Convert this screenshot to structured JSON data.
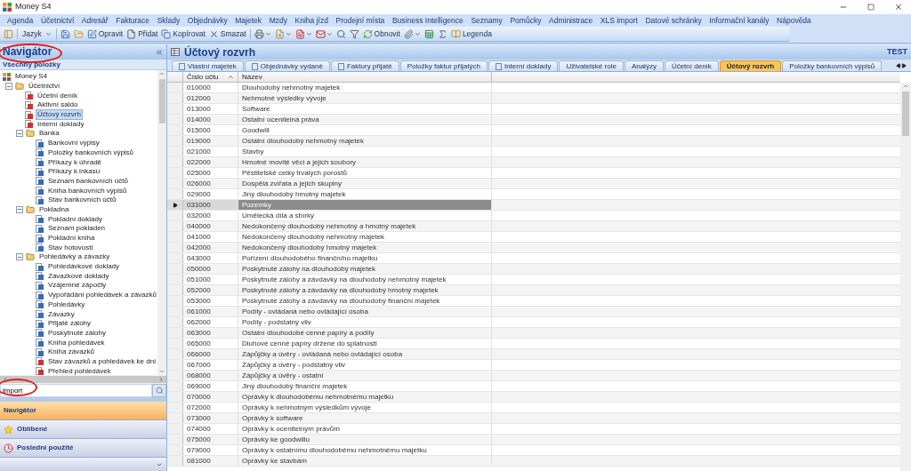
{
  "window": {
    "title": "Money S4"
  },
  "menu": [
    "Agenda",
    "Účetnictví",
    "Adresář",
    "Fakturace",
    "Sklady",
    "Objednávky",
    "Majetek",
    "Mzdy",
    "Kniha jízd",
    "Prodejní místa",
    "Business Intelligence",
    "Seznamy",
    "Pomůcky",
    "Administrace",
    "XLS import",
    "Datové schránky",
    "Informační kanály",
    "Nápověda"
  ],
  "toolbar": [
    {
      "kind": "icon"
    },
    {
      "kind": "separator"
    },
    {
      "kind": "dropdown",
      "label": "Jazyk"
    },
    {
      "kind": "separator"
    },
    {
      "kind": "icon"
    },
    {
      "kind": "icon"
    },
    {
      "kind": "button",
      "label": "Opravit"
    },
    {
      "kind": "button",
      "label": "Přidat"
    },
    {
      "kind": "button",
      "label": "Kopírovat"
    },
    {
      "kind": "button",
      "label": "Smazat"
    },
    {
      "kind": "separator"
    },
    {
      "kind": "icon_menu"
    },
    {
      "kind": "icon_menu"
    },
    {
      "kind": "icon_menu"
    },
    {
      "kind": "icon_menu"
    },
    {
      "kind": "icon"
    },
    {
      "kind": "icon"
    },
    {
      "kind": "button",
      "label": "Obnovit"
    },
    {
      "kind": "icon_menu"
    },
    {
      "kind": "icon"
    },
    {
      "kind": "icon"
    },
    {
      "kind": "button",
      "label": "Legenda"
    }
  ],
  "navigator": {
    "title": "Navigátor",
    "subtitle": "Všechny položky",
    "tree": [
      {
        "label": "Money S4",
        "selected": false,
        "children": [
          {
            "label": "Účetnictví",
            "selected": false,
            "expanded": true,
            "children": [
              {
                "label": "Účetní deník",
                "selected": false
              },
              {
                "label": "Aktivní saldo",
                "selected": false
              },
              {
                "label": "Účtový rozvrh",
                "selected": true
              },
              {
                "label": "Interní doklady",
                "selected": false
              },
              {
                "label": "Banka",
                "selected": false,
                "expanded": true,
                "children": [
                  {
                    "label": "Bankovní výpisy",
                    "selected": false
                  },
                  {
                    "label": "Položky bankovních výpisů",
                    "selected": false
                  },
                  {
                    "label": "Příkazy k úhradě",
                    "selected": false
                  },
                  {
                    "label": "Příkazy k inkasu",
                    "selected": false
                  },
                  {
                    "label": "Seznam bankovních účtů",
                    "selected": false
                  },
                  {
                    "label": "Kniha bankovních výpisů",
                    "selected": false
                  },
                  {
                    "label": "Stav bankovních účtů",
                    "selected": false
                  }
                ]
              },
              {
                "label": "Pokladna",
                "selected": false,
                "expanded": true,
                "children": [
                  {
                    "label": "Pokladní doklady",
                    "selected": false
                  },
                  {
                    "label": "Seznam pokladen",
                    "selected": false
                  },
                  {
                    "label": "Pokladní kniha",
                    "selected": false
                  },
                  {
                    "label": "Stav hotovosti",
                    "selected": false
                  }
                ]
              },
              {
                "label": "Pohledávky a závazky",
                "selected": false,
                "expanded": true,
                "children": [
                  {
                    "label": "Pohledávkové doklady",
                    "selected": false
                  },
                  {
                    "label": "Závazkové doklady",
                    "selected": false
                  },
                  {
                    "label": "Vzájemné zápočty",
                    "selected": false
                  },
                  {
                    "label": "Vypořádání pohledávek a závazků",
                    "selected": false
                  },
                  {
                    "label": "Pohledávky",
                    "selected": false
                  },
                  {
                    "label": "Závazky",
                    "selected": false
                  },
                  {
                    "label": "Přijaté zálohy",
                    "selected": false
                  },
                  {
                    "label": "Poskytnuté zálohy",
                    "selected": false
                  },
                  {
                    "label": "Kniha pohledávek",
                    "selected": false
                  },
                  {
                    "label": "Kniha závazků",
                    "selected": false
                  },
                  {
                    "label": "Stav závazků a pohledávek ke dni",
                    "selected": false
                  },
                  {
                    "label": "Přehled pohledávek",
                    "selected": false
                  }
                ]
              }
            ]
          }
        ]
      }
    ],
    "search": {
      "value": "import"
    },
    "sections": [
      {
        "label": "Navigátor",
        "selected": true
      },
      {
        "label": "Oblíbené",
        "selected": false
      },
      {
        "label": "Poslední použité",
        "selected": false
      }
    ]
  },
  "content": {
    "title": "Účtový rozvrh",
    "badge": "TEST",
    "tabs": [
      {
        "label": "Vlastní majetek",
        "has_icon": true,
        "selected": false
      },
      {
        "label": "Objednávky vydané",
        "has_icon": true,
        "selected": false
      },
      {
        "label": "Faktury přijaté",
        "has_icon": true,
        "selected": false
      },
      {
        "label": "Položky faktur přijatých",
        "has_icon": false,
        "selected": false
      },
      {
        "label": "Interní doklady",
        "has_icon": true,
        "selected": false
      },
      {
        "label": "Uživatelské role",
        "has_icon": false,
        "selected": false
      },
      {
        "label": "Analýzy",
        "has_icon": false,
        "selected": false
      },
      {
        "label": "Účetní deník",
        "has_icon": false,
        "selected": false
      },
      {
        "label": "Účtový rozvrh",
        "has_icon": false,
        "selected": true
      },
      {
        "label": "Položky bankovních výpisů",
        "has_icon": false,
        "selected": false
      }
    ],
    "table": {
      "columns": [
        {
          "label": "Číslo účtu",
          "sorted": true
        },
        {
          "label": "Název",
          "sorted": false
        }
      ],
      "rows": [
        {
          "cells": [
            "010000",
            "Dlouhodobý nehmotný majetek"
          ],
          "selected": false
        },
        {
          "cells": [
            "012000",
            "Nehmotné výsledky vývoje"
          ],
          "selected": false
        },
        {
          "cells": [
            "013000",
            "Software"
          ],
          "selected": false
        },
        {
          "cells": [
            "014000",
            "Ostatní ocenitelná práva"
          ],
          "selected": false
        },
        {
          "cells": [
            "015000",
            "Goodwill"
          ],
          "selected": false
        },
        {
          "cells": [
            "019000",
            "Ostatní dlouhodobý nehmotný majetek"
          ],
          "selected": false
        },
        {
          "cells": [
            "021000",
            "Stavby"
          ],
          "selected": false
        },
        {
          "cells": [
            "022000",
            "Hmotné movité věci a jejich soubory"
          ],
          "selected": false
        },
        {
          "cells": [
            "025000",
            "Pěstitelské celky trvalých porostů"
          ],
          "selected": false
        },
        {
          "cells": [
            "026000",
            "Dospělá zvířata a jejich skupiny"
          ],
          "selected": false
        },
        {
          "cells": [
            "029000",
            "Jiný dlouhodobý hmotný majetek"
          ],
          "selected": false
        },
        {
          "cells": [
            "031000",
            "Pozemky"
          ],
          "selected": true
        },
        {
          "cells": [
            "032000",
            "Umělecká díla a sbírky"
          ],
          "selected": false
        },
        {
          "cells": [
            "040000",
            "Nedokončený dlouhodobý nehmotný a hmotný majetek"
          ],
          "selected": false
        },
        {
          "cells": [
            "041000",
            "Nedokončený dlouhodobý nehmotný majetek"
          ],
          "selected": false
        },
        {
          "cells": [
            "042000",
            "Nedokončený dlouhodobý hmotný majetek"
          ],
          "selected": false
        },
        {
          "cells": [
            "043000",
            "Pořízení dlouhodobého finančního majetku"
          ],
          "selected": false
        },
        {
          "cells": [
            "050000",
            "Poskytnuté zálohy na dlouhodobý majetek"
          ],
          "selected": false
        },
        {
          "cells": [
            "051000",
            "Poskytnuté zálohy a závdavky na dlouhodobý nehmotný majetek"
          ],
          "selected": false
        },
        {
          "cells": [
            "052000",
            "Poskytnuté zálohy a závdavky na dlouhodobý hmotný majetek"
          ],
          "selected": false
        },
        {
          "cells": [
            "053000",
            "Poskytnuté zálohy a závdavky na dlouhodobý finanční majetek"
          ],
          "selected": false
        },
        {
          "cells": [
            "061000",
            "Podíly - ovládaná nebo ovládající osoba"
          ],
          "selected": false
        },
        {
          "cells": [
            "062000",
            "Podíly - podstatný vliv"
          ],
          "selected": false
        },
        {
          "cells": [
            "063000",
            "Ostatní dlouhodobé cenné papíry a podíly"
          ],
          "selected": false
        },
        {
          "cells": [
            "065000",
            "Dluhové cenné papíry držené do splatnosti"
          ],
          "selected": false
        },
        {
          "cells": [
            "066000",
            "Zápůjčky a úvěry - ovládaná nebo ovládající osoba"
          ],
          "selected": false
        },
        {
          "cells": [
            "067000",
            "Zápůjčky a úvěry - podstatný vliv"
          ],
          "selected": false
        },
        {
          "cells": [
            "068000",
            "Zápůjčky a úvěry - ostatní"
          ],
          "selected": false
        },
        {
          "cells": [
            "069000",
            "Jiný dlouhodobý finanční majetek"
          ],
          "selected": false
        },
        {
          "cells": [
            "070000",
            "Oprávky k dlouhodobému nehmotnému majetku"
          ],
          "selected": false
        },
        {
          "cells": [
            "072000",
            "Oprávky k nehmotným výsledkům vývoje"
          ],
          "selected": false
        },
        {
          "cells": [
            "073000",
            "Oprávky k software"
          ],
          "selected": false
        },
        {
          "cells": [
            "074000",
            "Oprávky k ocenitelným právům"
          ],
          "selected": false
        },
        {
          "cells": [
            "075000",
            "Oprávky ke goodwillu"
          ],
          "selected": false
        },
        {
          "cells": [
            "079000",
            "Oprávky k ostatnímu dlouhodobému nehmotnému majetku"
          ],
          "selected": false
        },
        {
          "cells": [
            "081000",
            "Oprávky ke stavbám"
          ],
          "selected": false
        }
      ]
    }
  }
}
